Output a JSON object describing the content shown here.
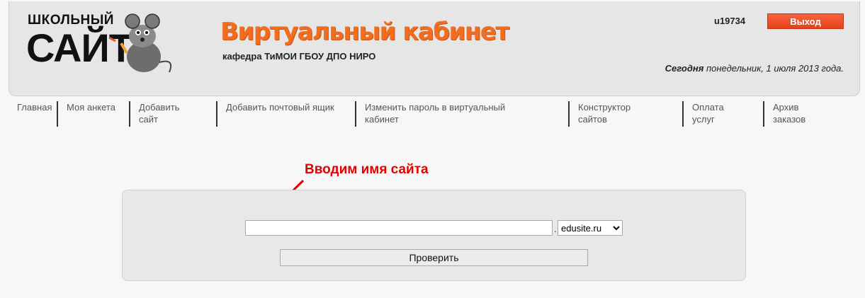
{
  "logo": {
    "small_text": "ШКОЛЬНЫЙ",
    "big_text": "САЙТ"
  },
  "header": {
    "title": "Виртуальный кабинет",
    "subtitle": "кафедра ТиМОИ ГБОУ ДПО НИРО",
    "user_id": "u19734",
    "logout_label": "Выход",
    "today_label": "Сегодня",
    "today_date": " понедельник, 1 июля 2013 года."
  },
  "nav": {
    "items": [
      {
        "label": "Главная"
      },
      {
        "label": "Моя анкета"
      },
      {
        "label": "Добавить сайт"
      },
      {
        "label": "Добавить почтовый ящик"
      },
      {
        "label": "Изменить пароль в виртуальный кабинет"
      },
      {
        "label": "Конструктор сайтов"
      },
      {
        "label": "Оплата услуг"
      },
      {
        "label": "Архив заказов"
      }
    ]
  },
  "annotation": {
    "text": "Вводим имя сайта"
  },
  "form": {
    "site_name_value": "",
    "separator": ".",
    "domain_selected": "edusite.ru",
    "check_label": "Проверить"
  },
  "colors": {
    "accent": "#f26d1e",
    "logout": "#e4411b",
    "annotation": "#e60000"
  }
}
